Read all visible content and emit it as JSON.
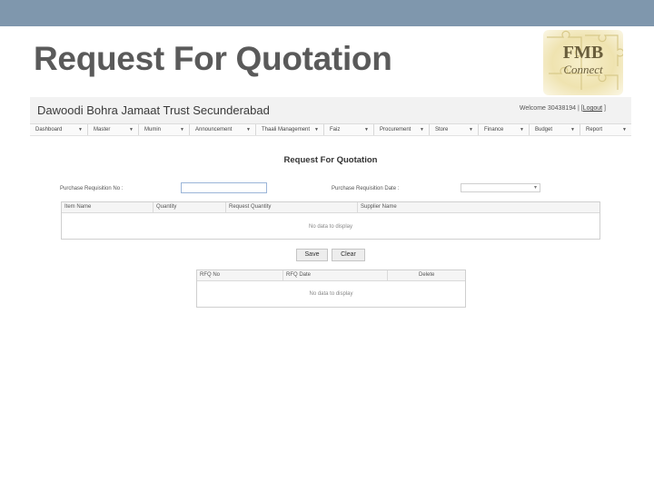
{
  "slide": {
    "title": "Request For Quotation"
  },
  "logo": {
    "line1": "FMB",
    "line2": "Connect"
  },
  "app": {
    "name": "Dawoodi Bohra Jamaat Trust Secunderabad",
    "welcome": "Welcome 30438194 | [",
    "logout": "Logout",
    "welcome_end": "]",
    "menu": [
      "Dashboard",
      "Master",
      "Mumin",
      "Announcement",
      "Thaali Management",
      "Faiz",
      "Procurement",
      "Store",
      "Finance",
      "Budget",
      "Report"
    ],
    "form": {
      "title": "Request For Quotation",
      "req_no_label": "Purchase Requisition No :",
      "req_no_value": "",
      "req_date_label": "Purchase Requisition Date :",
      "req_date_value": ""
    },
    "items_grid": {
      "columns": [
        "Item Name",
        "Quantity",
        "Request Quantity",
        "Supplier Name"
      ],
      "empty_text": "No data to display"
    },
    "buttons": {
      "save": "Save",
      "clear": "Clear"
    },
    "rfq_grid": {
      "columns": [
        "RFQ No",
        "RFQ Date",
        "Delete"
      ],
      "empty_text": "No data to display"
    }
  }
}
